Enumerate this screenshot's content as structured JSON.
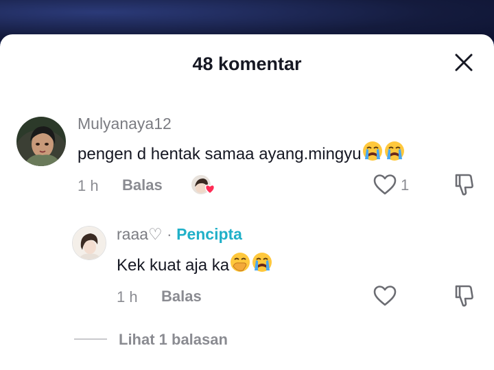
{
  "header": {
    "title": "48 komentar"
  },
  "comments": [
    {
      "username": "Mulyanaya12",
      "text": "pengen d hentak samaa ayang.mingyu",
      "time": "1 h",
      "reply_label": "Balas",
      "like_count": "1"
    }
  ],
  "reply": {
    "username": "raaa♡",
    "separator": "·",
    "badge": "Pencipta",
    "text": "Kek kuat aja ka",
    "time": "1 h",
    "reply_label": "Balas"
  },
  "see_replies": "Lihat 1 balasan",
  "colors": {
    "creator": "#20b0c8",
    "heart_badge": "#fe2c55"
  }
}
